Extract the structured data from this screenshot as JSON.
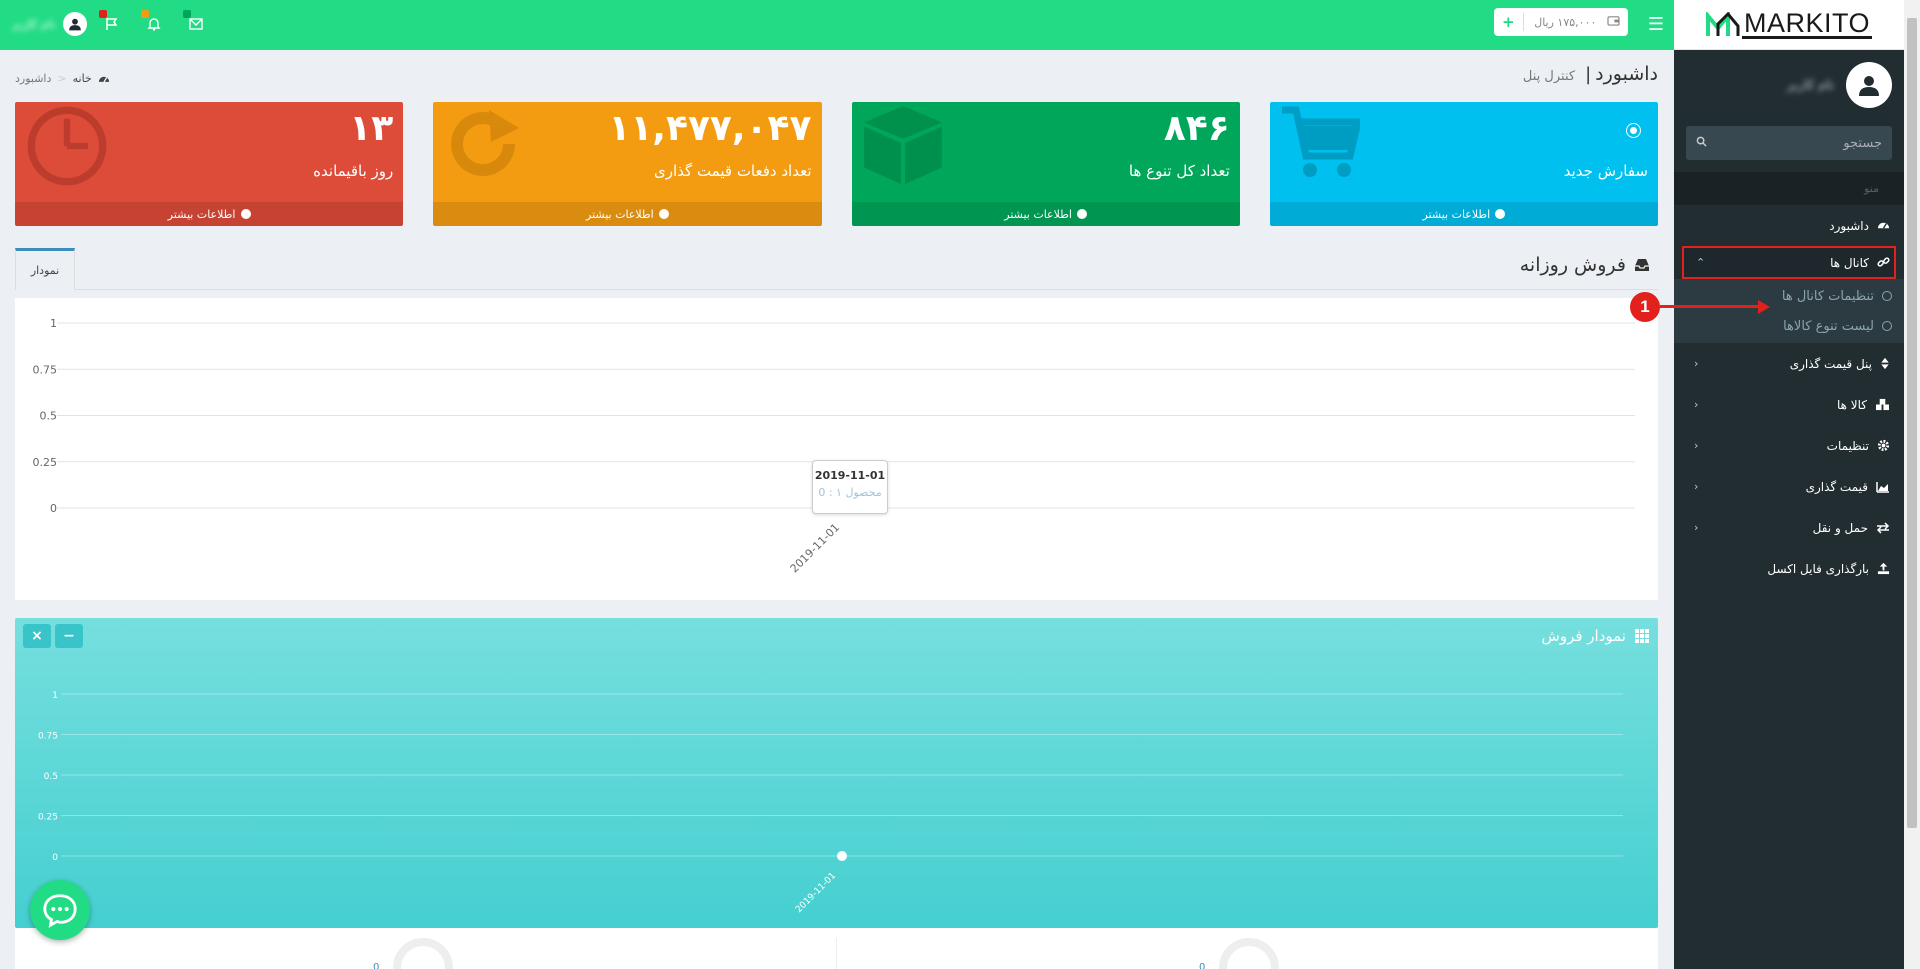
{
  "sidebar": {
    "logo_text": "MARKITO",
    "user_name": "نام کاربر",
    "search_placeholder": "جستجو",
    "menu_header": "منو",
    "items": [
      {
        "label": "داشبورد",
        "icon": "dashboard-icon"
      },
      {
        "label": "کانال ها",
        "icon": "link-icon",
        "active": true,
        "children": [
          {
            "label": "تنظیمات کانال ها"
          },
          {
            "label": "لیست تنوع کالاها"
          }
        ]
      },
      {
        "label": "پنل قیمت گذاری",
        "icon": "sort-icon"
      },
      {
        "label": "کالا ها",
        "icon": "cubes-icon"
      },
      {
        "label": "تنظیمات",
        "icon": "gear-icon"
      },
      {
        "label": "قیمت گذاری",
        "icon": "area-chart-icon"
      },
      {
        "label": "حمل و نقل",
        "icon": "exchange-icon"
      },
      {
        "label": "بارگذاری فایل اکسل",
        "icon": "upload-icon"
      }
    ]
  },
  "topbar": {
    "wallet": "۱۷۵,۰۰۰ ریال",
    "user_name": "نام کاربر",
    "badge_colors": [
      "#e2201c",
      "#f39c12",
      "#00a65a"
    ]
  },
  "header": {
    "title": "داشبورد",
    "subtitle": "کنترل پنل",
    "breadcrumb": [
      "خانه",
      "داشبورد"
    ]
  },
  "stat_boxes": [
    {
      "value": "",
      "label": "سفارش جدید",
      "footer": "اطلاعات بیشتر",
      "color": "#00c0ef",
      "icon": "shopping-cart-icon"
    },
    {
      "value": "۸۴۶",
      "label": "تعداد کل تنوع ها",
      "footer": "اطلاعات بیشتر",
      "color": "#00a65a",
      "icon": "cube-icon"
    },
    {
      "value": "۱۱,۴۷۷,۰۴۷",
      "label": "تعداد دفعات قیمت گذاری",
      "footer": "اطلاعات بیشتر",
      "color": "#f39c12",
      "icon": "refresh-icon"
    },
    {
      "value": "۱۳",
      "label": "روز باقیمانده",
      "footer": "اطلاعات بیشتر",
      "color": "#dd4b39",
      "icon": "clock-icon"
    }
  ],
  "daily_sales": {
    "title": "فروش روزانه",
    "tab": "نمودار",
    "tooltip": {
      "date": "2019-11-01",
      "text": "محصول ۱ : 0"
    }
  },
  "sales_chart_panel": {
    "title": "نمودار فروش"
  },
  "chart_data": [
    {
      "type": "line",
      "x": [
        "2019-11-01"
      ],
      "series": [
        {
          "name": "محصول ۱",
          "values": [
            0
          ]
        }
      ],
      "yticks": [
        "0",
        "0.25",
        "0.5",
        "0.75",
        "1"
      ],
      "ylim": [
        0,
        1
      ],
      "grid": true
    },
    {
      "type": "line",
      "x": [
        "2019-11-01"
      ],
      "series": [
        {
          "values": [
            0
          ]
        }
      ],
      "yticks": [
        "0",
        "0.25",
        "0.5",
        "0.75",
        "1"
      ],
      "ylim": [
        0,
        1
      ],
      "grid": true
    }
  ],
  "annotation": {
    "label": "1"
  },
  "knob_values": [
    "0",
    "0"
  ]
}
